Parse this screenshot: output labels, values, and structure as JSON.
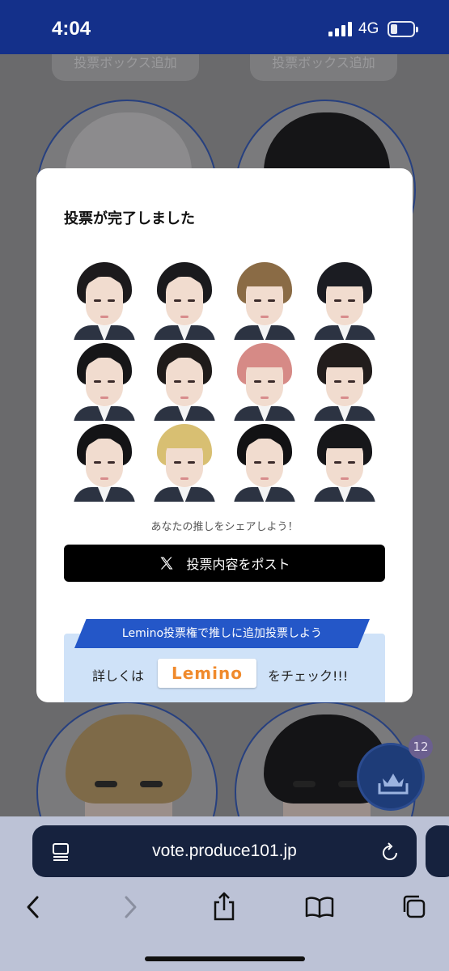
{
  "status": {
    "time": "4:04",
    "network": "4G"
  },
  "background": {
    "add_box_left": "投票ボックス追加",
    "add_box_right": "投票ボックス追加",
    "badge_count": "12"
  },
  "modal": {
    "title": "投票が完了しました",
    "share_prompt": "あなたの推しをシェアしよう！",
    "post_button": "投票内容をポスト",
    "lemino_banner": "Lemino投票権で推しに追加投票しよう",
    "lemino_prefix": "詳しくは",
    "lemino_logo": "Lemino",
    "lemino_suffix": "をチェック!!!",
    "trainees": [
      {
        "hair": "#1c1a1c",
        "style": "part"
      },
      {
        "hair": "#1a1a1d",
        "style": "part"
      },
      {
        "hair": "#8a6b45",
        "style": "fringe"
      },
      {
        "hair": "#1b1c22",
        "style": "fringe"
      },
      {
        "hair": "#161618",
        "style": "part"
      },
      {
        "hair": "#1f1b1a",
        "style": "part"
      },
      {
        "hair": "#d68a86",
        "style": "fringe"
      },
      {
        "hair": "#221d1c",
        "style": "fringe"
      },
      {
        "hair": "#141416",
        "style": "part"
      },
      {
        "hair": "#d8bf72",
        "style": "fringe"
      },
      {
        "hair": "#121214",
        "style": "part"
      },
      {
        "hair": "#17171a",
        "style": "fringe"
      }
    ]
  },
  "browser": {
    "url": "vote.produce101.jp"
  }
}
